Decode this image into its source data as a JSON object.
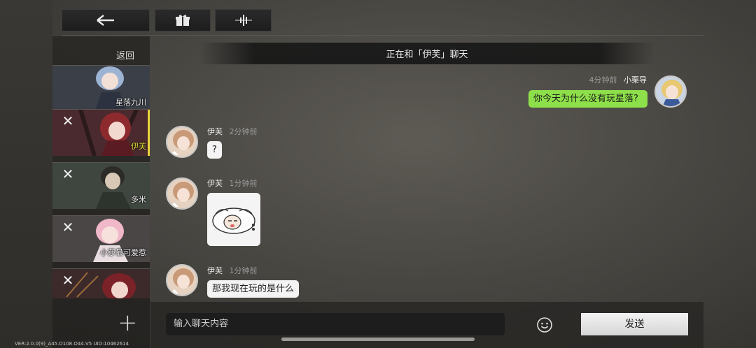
{
  "toolbar": {
    "back_icon": "back-arrow-icon",
    "gift_icon": "gift-icon",
    "voice_icon": "audio-wave-icon"
  },
  "sidebar": {
    "back_label": "返回",
    "add_icon": "plus-icon",
    "chats": [
      {
        "name": "星落九川",
        "closable": false,
        "active": false
      },
      {
        "name": "伊芙",
        "closable": true,
        "active": true
      },
      {
        "name": "多米",
        "closable": true,
        "active": false
      },
      {
        "name": "小莎最可爱惹",
        "closable": true,
        "active": false
      },
      {
        "name": "",
        "closable": true,
        "active": false
      }
    ]
  },
  "header": {
    "title": "正在和「伊芙」聊天"
  },
  "messages": [
    {
      "sender": "小栗导",
      "time": "4分钟前",
      "text": "你今天为什么没有玩星落?",
      "mine": true
    },
    {
      "sender": "伊芙",
      "time": "2分钟前",
      "text": "?",
      "mine": false
    },
    {
      "sender": "伊芙",
      "time": "1分钟前",
      "text": "",
      "sticker": "sleeping-chibi-sticker",
      "mine": false
    },
    {
      "sender": "伊芙",
      "time": "1分钟前",
      "text": "那我现在玩的是什么",
      "mine": false
    }
  ],
  "composer": {
    "placeholder": "输入聊天内容",
    "emoji_icon": "smiley-icon",
    "send_label": "发送"
  },
  "footer": {
    "version": "VER:2.0.0(9)_A45.D108.O44.V5   UID:10462614"
  },
  "colors": {
    "my_bubble": "#8ee04a",
    "active_chat_name": "#e8e23c",
    "their_bubble": "#f4f4f4"
  }
}
